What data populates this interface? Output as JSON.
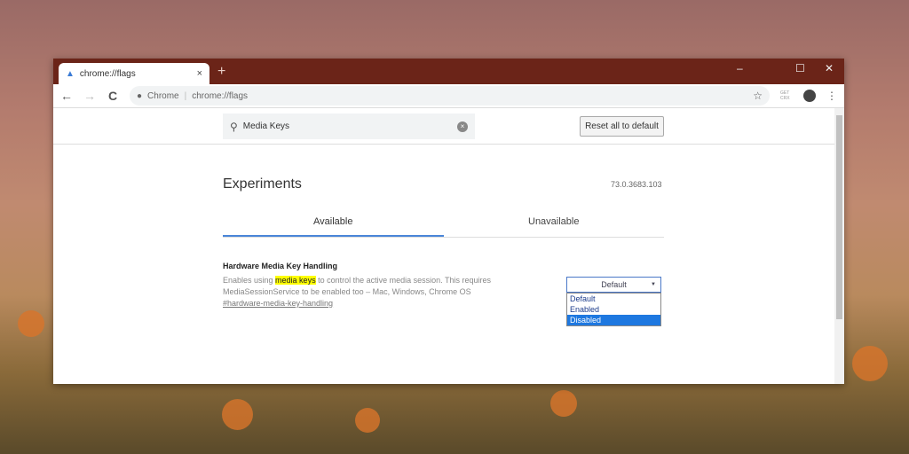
{
  "tab": {
    "title": "chrome://flags",
    "close": "×",
    "new_tab": "+"
  },
  "window_controls": {
    "minimize": "–",
    "maximize": "☐",
    "close": "✕"
  },
  "toolbar": {
    "back": "←",
    "forward": "→",
    "reload": "C",
    "site_label": "Chrome",
    "separator": "|",
    "url": "chrome://flags",
    "extension": "GET CRX",
    "menu": "⋮"
  },
  "search": {
    "value": "Media Keys",
    "clear": "×"
  },
  "reset_button": "Reset all to default",
  "page": {
    "title": "Experiments",
    "version": "73.0.3683.103"
  },
  "tabs": [
    {
      "label": "Available",
      "active": true
    },
    {
      "label": "Unavailable",
      "active": false
    }
  ],
  "experiment": {
    "title": "Hardware Media Key Handling",
    "desc_before": "Enables using ",
    "desc_highlight": "media keys",
    "desc_after": " to control the active media session. This requires MediaSessionService to be enabled too – Mac, Windows, Chrome OS",
    "link": "#hardware-media-key-handling",
    "select": {
      "value": "Default",
      "options": [
        "Default",
        "Enabled",
        "Disabled"
      ],
      "highlighted": "Disabled"
    }
  },
  "colors": {
    "titlebar": "#6b2418",
    "accent": "#4a86d8",
    "highlight": "#ffff00"
  }
}
